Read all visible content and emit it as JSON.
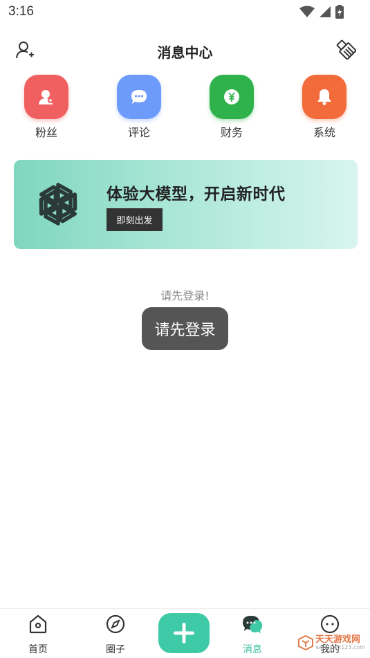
{
  "status_bar": {
    "time": "3:16"
  },
  "header": {
    "title": "消息中心"
  },
  "quick_entries": [
    {
      "label": "粉丝",
      "color": "#f06060",
      "icon": "fans-icon"
    },
    {
      "label": "评论",
      "color": "#6d9bfb",
      "icon": "comment-icon"
    },
    {
      "label": "财务",
      "color": "#2fb24c",
      "icon": "finance-icon"
    },
    {
      "label": "系统",
      "color": "#f26b3a",
      "icon": "bell-icon"
    }
  ],
  "banner": {
    "title": "体验大模型，开启新时代",
    "button": "即刻出发"
  },
  "login_hint": "请先登录!",
  "toast": "请先登录",
  "bottom_nav": [
    {
      "label": "首页",
      "icon": "home-icon",
      "active": false
    },
    {
      "label": "圈子",
      "icon": "compass-icon",
      "active": false
    },
    {
      "label": "消息",
      "icon": "message-icon",
      "active": true
    },
    {
      "label": "我的",
      "icon": "profile-icon",
      "active": false
    }
  ],
  "accent_color": "#3ec9a7",
  "watermark": {
    "text": "天天游戏网",
    "sub": "www.ttyx123.com"
  }
}
